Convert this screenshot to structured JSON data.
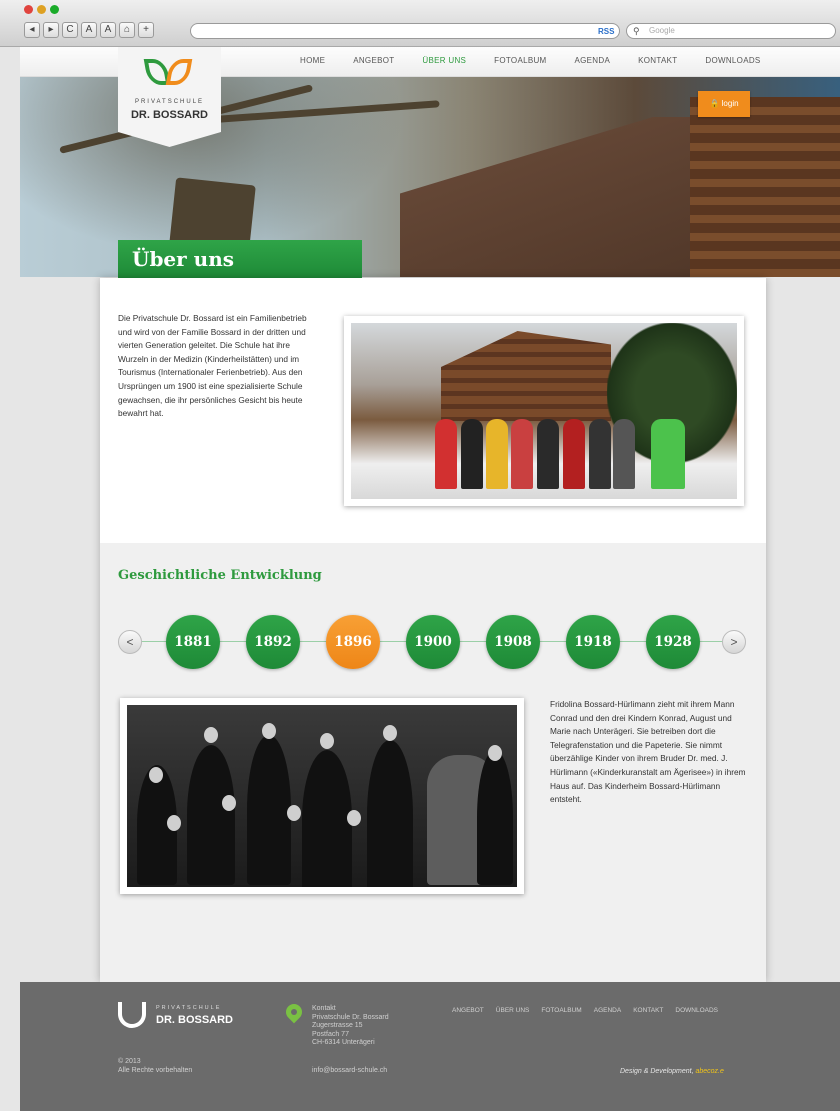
{
  "browser": {
    "rss": "RSS",
    "search_placeholder": "Google",
    "buttons": [
      "◂",
      "▸",
      "C",
      "A",
      "A",
      "⌂",
      "+"
    ]
  },
  "nav": {
    "items": [
      "HOME",
      "ANGEBOT",
      "ÜBER UNS",
      "FOTOALBUM",
      "AGENDA",
      "KONTAKT",
      "DOWNLOADS"
    ],
    "active": "ÜBER UNS"
  },
  "login": {
    "label": "login"
  },
  "logo": {
    "sub": "PRIVATSCHULE",
    "name": "DR. BOSSARD"
  },
  "page_title": "Über uns",
  "intro_text": "Die Privatschule Dr. Bossard ist ein Familienbetrieb und wird von der Familie Bossard in der dritten und vierten Generation geleitet. Die Schule hat ihre Wurzeln in der Medizin (Kinderheilstätten) und im Tourismus (Internationaler Ferienbetrieb). Aus den Ursprüngen um 1900 ist eine spezialisierte Schule gewachsen, die ihr persönliches Gesicht bis heute bewahrt hat.",
  "history": {
    "title": "Geschichtliche Entwicklung",
    "prev": "<",
    "next": ">",
    "years": [
      "1881",
      "1892",
      "1896",
      "1900",
      "1908",
      "1918",
      "1928"
    ],
    "selected": "1896",
    "text": "Fridolina Bossard-Hürlimann zieht mit ihrem Mann Conrad und den drei Kindern Konrad, August und Marie nach Unterägeri. Sie betreiben dort die Telegrafenstation und die Papeterie. Sie nimmt überzählige Kinder von ihrem Bruder Dr. med. J. Hürlimann («Kinderkuranstalt am Ägerisee») in ihrem Haus auf. Das Kinderheim Bossard-Hürlimann entsteht."
  },
  "footer": {
    "logo_sub": "PRIVATSCHULE",
    "logo_name": "DR. BOSSARD",
    "copyright": "© 2013",
    "rights": "Alle Rechte vorbehalten",
    "contact_lines": [
      "Kontakt",
      "Privatschule Dr. Bossard",
      "Zugerstrasse 15",
      "Postfach 77",
      "CH-6314 Unterägeri"
    ],
    "email": "info@bossard-schule.ch",
    "menu": [
      "ANGEBOT",
      "ÜBER UNS",
      "FOTOALBUM",
      "AGENDA",
      "KONTAKT",
      "DOWNLOADS"
    ],
    "design_label": "Design & Development",
    "design_by": "abecoz.e"
  },
  "colors": {
    "green": "#2e9a3e",
    "orange": "#f08c1c",
    "footer": "#6b6b6b"
  }
}
